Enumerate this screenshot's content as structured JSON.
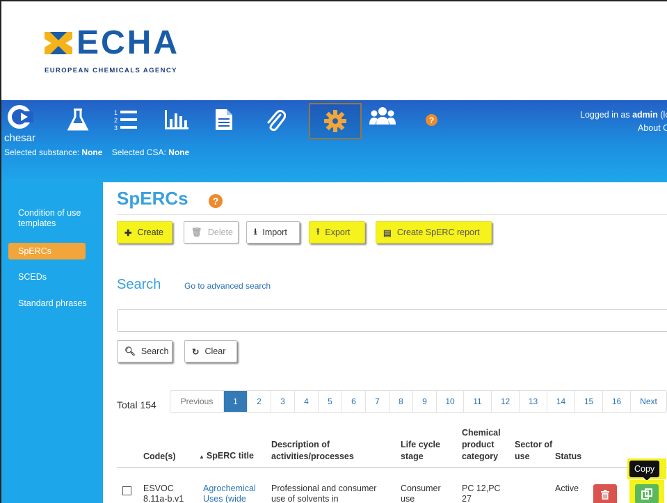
{
  "logo": {
    "name": "ECHA",
    "subtitle": "EUROPEAN CHEMICALS AGENCY"
  },
  "app": {
    "name": "chesar"
  },
  "header": {
    "logged_in_prefix": "Logged in as",
    "user": "admin",
    "user_suffix": "(lo",
    "about": "About C",
    "selected_substance_label": "Selected substance:",
    "selected_substance": "None",
    "selected_csa_label": "Selected CSA:",
    "selected_csa": "None"
  },
  "nav": {
    "icons": [
      "flask-icon",
      "list-icon",
      "chart-icon",
      "document-icon",
      "paperclip-icon",
      "gear-icon",
      "users-icon",
      "help-icon"
    ],
    "active": "gear-icon",
    "help_glyph": "?"
  },
  "sidebar": {
    "items": [
      {
        "label": "Condition of use templates"
      },
      {
        "label": "SpERCs",
        "active": true
      },
      {
        "label": "SCEDs"
      },
      {
        "label": "Standard phrases"
      }
    ]
  },
  "page": {
    "title": "SpERCs"
  },
  "toolbar": {
    "create": "Create",
    "delete": "Delete",
    "import": "Import",
    "export": "Export",
    "report": "Create SpERC report"
  },
  "search": {
    "title": "Search",
    "advanced_link": "Go to advanced search",
    "input_value": "",
    "search_button": "Search",
    "clear_button": "Clear"
  },
  "pagination": {
    "total_label": "Total 154",
    "previous": "Previous",
    "pages": [
      "1",
      "2",
      "3",
      "4",
      "5",
      "6",
      "7",
      "8",
      "9",
      "10",
      "11",
      "12",
      "13",
      "14",
      "15",
      "16"
    ],
    "current": "1",
    "next": "Next"
  },
  "table": {
    "columns": [
      "Code(s)",
      "SpERC title",
      "Description of activities/processes",
      "Life cycle stage",
      "Chemical product category",
      "Sector of use",
      "Status"
    ],
    "sort_indicator": "▲",
    "rows": [
      {
        "code": "ESVOC 8.11a-b.v1",
        "title": "Agrochemical Uses (wide",
        "description": "Professional and consumer use of solvents in",
        "life_cycle": "Consumer use",
        "category": "PC 12,PC 27",
        "sector": "",
        "status": "Active"
      }
    ]
  },
  "tooltip": {
    "text": "Copy"
  },
  "colors": {
    "brand_blue": "#1a5ca8",
    "header_blue": "#2360c5",
    "sidebar_blue": "#1ea6ea",
    "highlight_yellow": "#f5f21c",
    "active_orange": "#f2a53a",
    "title_blue": "#3aa0dc",
    "page_active": "#337ab7",
    "delete_red": "#d9534f",
    "copy_green": "#5cb85c"
  }
}
